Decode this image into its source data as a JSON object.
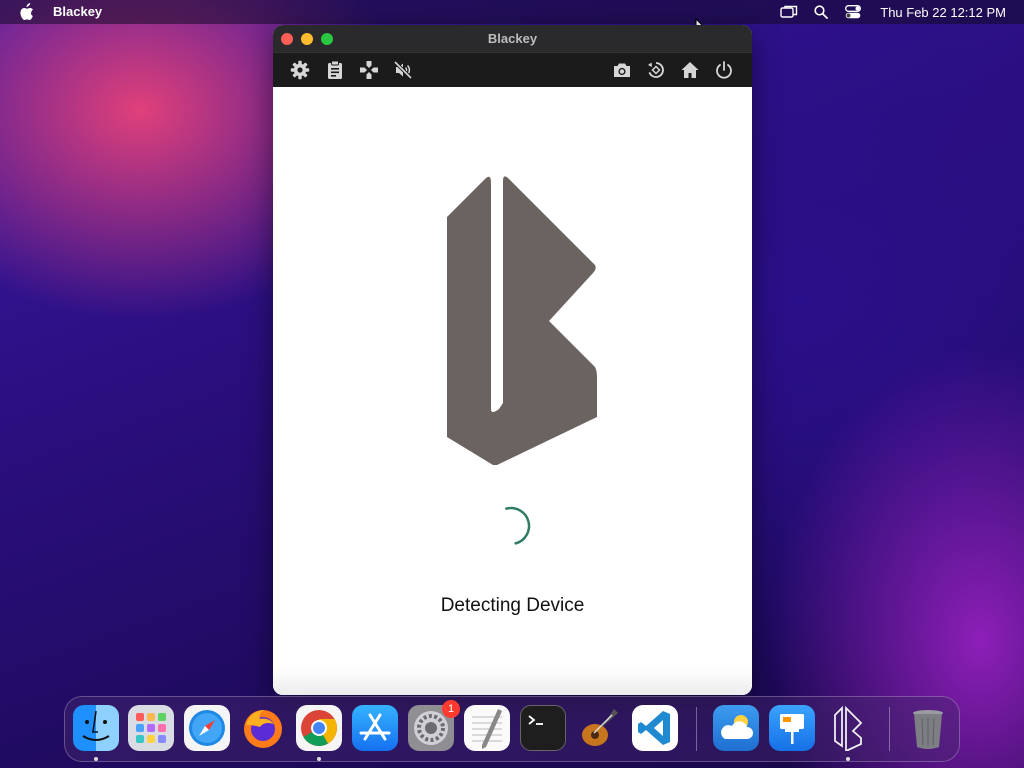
{
  "menubar": {
    "app_name": "Blackey",
    "clock": "Thu Feb 22  12:12 PM",
    "icons": [
      "apple-logo-icon",
      "screen-mirroring-icon",
      "spotlight-search-icon",
      "control-center-icon"
    ]
  },
  "window": {
    "title": "Blackey",
    "toolbar_icons_left": [
      "gear-icon",
      "clipboard-icon",
      "gamepad-icon",
      "speaker-muted-icon"
    ],
    "toolbar_icons_right": [
      "camera-icon",
      "rotate-icon",
      "home-icon",
      "power-icon"
    ],
    "status_text": "Detecting Device",
    "logo_color": "#6b6360",
    "spinner_color": "#2e7d62"
  },
  "dock": {
    "items": [
      "finder-icon",
      "launchpad-icon",
      "safari-icon",
      "firefox-icon",
      "chrome-icon",
      "app-store-icon",
      "system-settings-icon",
      "textedit-icon",
      "terminal-icon",
      "garageband-icon",
      "vscode-icon",
      "weather-icon",
      "keynote-icon",
      "blackey-icon",
      "trash-icon"
    ],
    "settings_badge": "1"
  },
  "colors": {
    "titlebar": "#2a2a2c",
    "toolbar": "#1b1b1b",
    "accent_green": "#2e7d62"
  }
}
